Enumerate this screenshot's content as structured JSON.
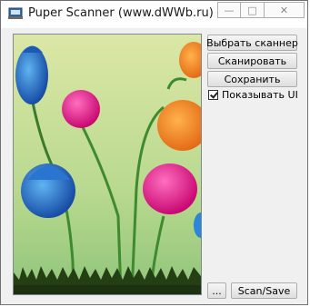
{
  "window": {
    "title": "Puper Scanner (www.dWWb.ru)",
    "controls": {
      "minimize": "—",
      "maximize": "□",
      "close": "✕"
    }
  },
  "preview": {
    "description_icon": "tulip-image",
    "colors": {
      "sky_top": "#d9e6a3",
      "sky_bottom": "#a6cf8a",
      "grass": "#2b4a1a"
    }
  },
  "buttons": {
    "select_scanner": "Выбрать сканнер",
    "scan": "Сканировать",
    "save": "Сохранить",
    "browse": "...",
    "scan_save": "Scan/Save"
  },
  "options": {
    "show_ui_label": "Показывать UI",
    "show_ui_checked": true
  }
}
